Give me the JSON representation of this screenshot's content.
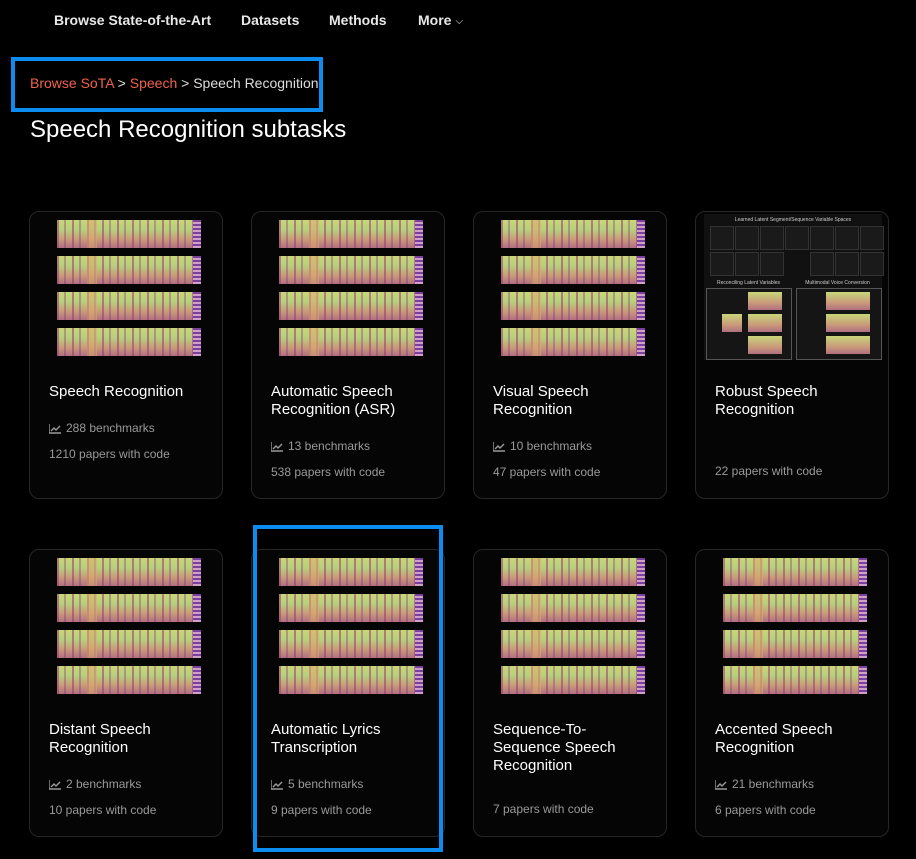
{
  "nav": {
    "items": [
      {
        "label": "Browse State-of-the-Art"
      },
      {
        "label": "Datasets"
      },
      {
        "label": "Methods"
      },
      {
        "label": "More"
      }
    ]
  },
  "breadcrumb": {
    "items": [
      "Browse SoTA",
      "Speech"
    ],
    "separator": ">",
    "current": "Speech Recognition"
  },
  "page_title": "Speech Recognition subtasks",
  "cards": [
    {
      "title": "Speech Recognition",
      "benchmarks": "288 benchmarks",
      "papers": "1210 papers with code"
    },
    {
      "title": "Automatic Speech Recognition (ASR)",
      "benchmarks": "13 benchmarks",
      "papers": "538 papers with code"
    },
    {
      "title": "Visual Speech Recognition",
      "benchmarks": "10 benchmarks",
      "papers": "47 papers with code"
    },
    {
      "title": "Robust Speech Recognition",
      "benchmarks": "",
      "papers": "22 papers with code",
      "thumb_text": {
        "top": "Learned Latent Segment/Sequence Variable Spaces",
        "left": "Reconciling Latent Variables",
        "right": "Multimodal Voice Conversion"
      }
    },
    {
      "title": "Distant Speech Recognition",
      "benchmarks": "2 benchmarks",
      "papers": "10 papers with code"
    },
    {
      "title": "Automatic Lyrics Transcription",
      "benchmarks": "5 benchmarks",
      "papers": "9 papers with code"
    },
    {
      "title": "Sequence-To-Sequence Speech Recognition",
      "benchmarks": "",
      "papers": "7 papers with code"
    },
    {
      "title": "Accented Speech Recognition",
      "benchmarks": "21 benchmarks",
      "papers": "6 papers with code"
    }
  ],
  "colors": {
    "accent_link": "#f0624d",
    "highlight": "#0d8cf0",
    "background": "#000000"
  },
  "icons": {
    "chevron": "chevron-down-icon",
    "benchmark": "line-chart-icon"
  }
}
